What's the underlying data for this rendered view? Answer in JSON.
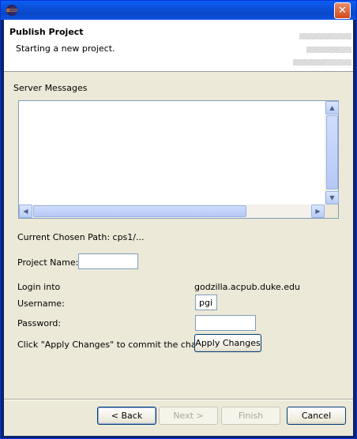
{
  "window": {
    "close_glyph": "✕"
  },
  "header": {
    "title": "Publish Project",
    "subtitle": "Starting a new project."
  },
  "server_messages": {
    "label": "Server Messages",
    "content": ""
  },
  "path": {
    "text": "Current Chosen Path: cps1/..."
  },
  "project_name": {
    "label": "Project Name:",
    "value": ""
  },
  "login": {
    "label": "Login into",
    "host": "godzilla.acpub.duke.edu",
    "username_label": "Username:",
    "username_value": "pgi",
    "password_label": "Password:",
    "password_value": ""
  },
  "apply": {
    "hint": "Click \"Apply Changes\" to commit the changes.",
    "button": "Apply Changes"
  },
  "footer": {
    "back": "< Back",
    "next": "Next >",
    "finish": "Finish",
    "cancel": "Cancel"
  },
  "colors": {
    "titlebar": "#0b4fd8",
    "dialog_bg": "#ece9d8",
    "close_button": "#d2491c"
  }
}
